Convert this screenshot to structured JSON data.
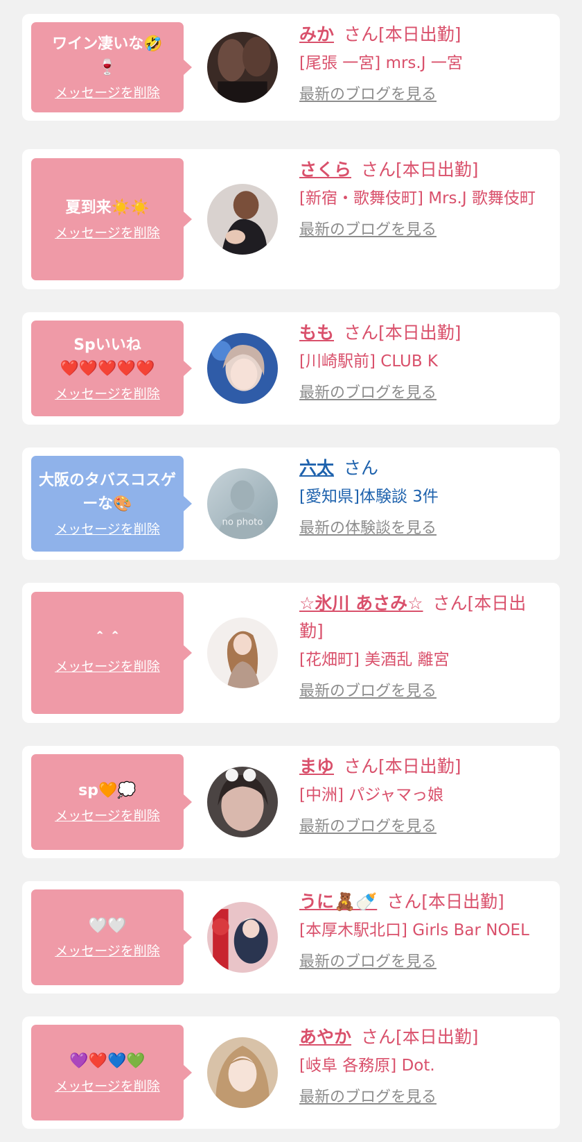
{
  "items": [
    {
      "message": "ワイン凄いな🤣\n🍷",
      "delete_label": "メッセージを削除",
      "name": "みか",
      "honorific": "さん[本日出勤]",
      "shop": "[尾張 一宮] mrs.J 一宮",
      "more_label": "最新のブログを見る",
      "kind": "cast"
    },
    {
      "message": "夏到来☀️☀️",
      "delete_label": "メッセージを削除",
      "name": "さくら",
      "honorific": "さん[本日出勤]",
      "shop": "[新宿・歌舞伎町] Mrs.J 歌舞伎町",
      "more_label": "最新のブログを見る",
      "kind": "cast"
    },
    {
      "message": "Spいいね\n❤️❤️❤️❤️❤️",
      "delete_label": "メッセージを削除",
      "name": "もも",
      "honorific": "さん[本日出勤]",
      "shop": "[川崎駅前] CLUB K",
      "more_label": "最新のブログを見る",
      "kind": "cast"
    },
    {
      "message": "大阪のタバスコスゲーな🎨",
      "delete_label": "メッセージを削除",
      "name": "六太",
      "honorific": "さん",
      "shop": "[愛知県]体験談 3件",
      "more_label": "最新の体験談を見る",
      "kind": "user",
      "avatar_text": "no photo"
    },
    {
      "message": "＾＾",
      "delete_label": "メッセージを削除",
      "name": "☆氷川 あさみ☆",
      "honorific": "さん[本日出勤]",
      "shop": "[花畑町] 美酒乱 離宮",
      "more_label": "最新のブログを見る",
      "kind": "cast"
    },
    {
      "message": "sp🧡💭",
      "delete_label": "メッセージを削除",
      "name": "まゆ",
      "honorific": "さん[本日出勤]",
      "shop": "[中洲] パジャマっ娘",
      "more_label": "最新のブログを見る",
      "kind": "cast"
    },
    {
      "message": "🤍🤍",
      "delete_label": "メッセージを削除",
      "name": "うに🧸🍼",
      "honorific": "さん[本日出勤]",
      "shop": "[本厚木駅北口] Girls Bar NOEL",
      "more_label": "最新のブログを見る",
      "kind": "cast"
    },
    {
      "message": "💜❤️💙💚",
      "delete_label": "メッセージを削除",
      "name": "あやか",
      "honorific": "さん[本日出勤]",
      "shop": "[岐阜 各務原] Dot.",
      "more_label": "最新のブログを見る",
      "kind": "cast"
    }
  ],
  "colors": {
    "cast_text": "#d9506b",
    "user_text": "#1e62ad",
    "cast_bubble": "#ef9aa7",
    "user_bubble": "#8fb2ea",
    "link_gray": "#8c8c8c",
    "page_bg": "#f1f1f1"
  }
}
